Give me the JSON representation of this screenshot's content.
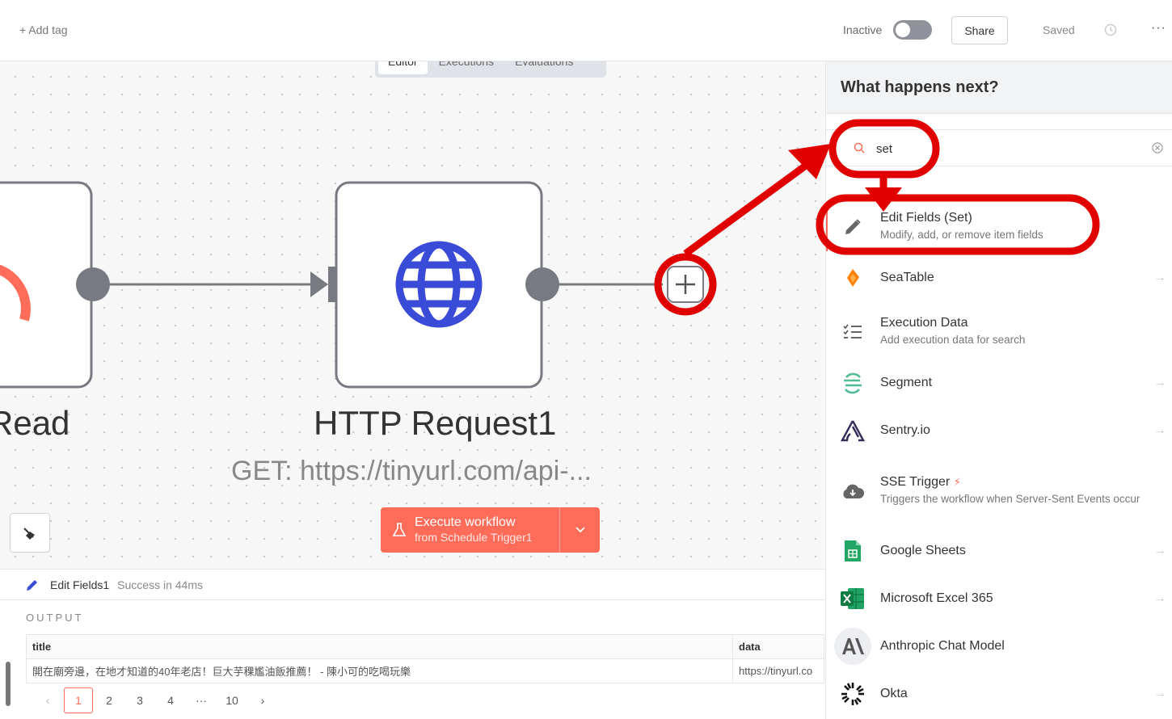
{
  "topbar": {
    "add_tag": "+ Add tag",
    "status_label": "Inactive",
    "share": "Share",
    "saved": "Saved",
    "more": "···"
  },
  "tabs": [
    {
      "label": "Editor",
      "active": true
    },
    {
      "label": "Executions",
      "active": false
    },
    {
      "label": "Evaluations",
      "active": false
    }
  ],
  "nodes": {
    "left_label": "Read",
    "http_label": "HTTP Request1",
    "http_sub": "GET: https://tinyurl.com/api-..."
  },
  "execute": {
    "title": "Execute workflow",
    "sub": "from Schedule Trigger1"
  },
  "output": {
    "node_name": "Edit Fields1",
    "status": "Success in 44ms",
    "section_label": "OUTPUT",
    "columns": [
      "title",
      "data"
    ],
    "rows": [
      [
        "開在廟旁邊，在地才知道的40年老店！巨大芋稞尷油飯推薦！ - 陳小可的吃喝玩樂",
        "https://tinyurl.co"
      ]
    ],
    "pages": [
      "1",
      "2",
      "3",
      "4",
      "···",
      "10"
    ],
    "current_page": "1"
  },
  "panel": {
    "title": "What happens next?",
    "search_value": "set",
    "items": [
      {
        "name": "Edit Fields (Set)",
        "desc": "Modify, add, or remove item fields",
        "icon": "pencil-icon",
        "arrow": false
      },
      {
        "name": "SeaTable",
        "desc": "",
        "icon": "seatable-icon",
        "arrow": true
      },
      {
        "name": "Execution Data",
        "desc": "Add execution data for search",
        "icon": "execution-data-icon",
        "arrow": false
      },
      {
        "name": "Segment",
        "desc": "",
        "icon": "segment-icon",
        "arrow": true
      },
      {
        "name": "Sentry.io",
        "desc": "",
        "icon": "sentry-icon",
        "arrow": true
      },
      {
        "name": "SSE Trigger",
        "desc": "Triggers the workflow when Server-Sent Events occur",
        "icon": "cloud-download-icon",
        "arrow": false
      },
      {
        "name": "Google Sheets",
        "desc": "",
        "icon": "google-sheets-icon",
        "arrow": true
      },
      {
        "name": "Microsoft Excel 365",
        "desc": "",
        "icon": "excel-icon",
        "arrow": true
      },
      {
        "name": "Anthropic Chat Model",
        "desc": "",
        "icon": "anthropic-icon",
        "arrow": false
      },
      {
        "name": "Okta",
        "desc": "",
        "icon": "okta-icon",
        "arrow": true
      }
    ]
  },
  "colors": {
    "accent": "#ff6d5a",
    "annotation": "#e00000",
    "globe": "#3a4bd8"
  }
}
